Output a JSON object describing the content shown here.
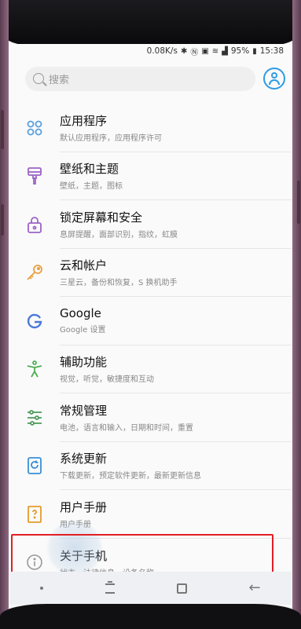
{
  "status_bar": {
    "speed": "0.08K/s",
    "icons": [
      "bluetooth-icon",
      "nfc-icon",
      "vibrate-icon",
      "wifi-icon",
      "signal-icon",
      "battery-icon"
    ],
    "battery": "95%",
    "time": "15:38"
  },
  "search": {
    "placeholder": "搜索"
  },
  "settings": [
    {
      "title": "应用程序",
      "subtitle": "默认应用程序，应用程序许可",
      "icon": "apps-icon",
      "color": "#5aa0e0"
    },
    {
      "title": "壁纸和主题",
      "subtitle": "壁纸，主题，图标",
      "icon": "brush-icon",
      "color": "#9a64c8"
    },
    {
      "title": "锁定屏幕和安全",
      "subtitle": "息屏提醒，面部识别，指纹，虹膜",
      "icon": "lock-icon",
      "color": "#9a64c8"
    },
    {
      "title": "云和帐户",
      "subtitle": "三星云，备份和恢复，S 换机助手",
      "icon": "key-icon",
      "color": "#e9a040"
    },
    {
      "title": "Google",
      "subtitle": "Google 设置",
      "icon": "google-icon",
      "color": "#4a78d8"
    },
    {
      "title": "辅助功能",
      "subtitle": "视觉，听觉，敏捷度和互动",
      "icon": "accessibility-icon",
      "color": "#4caf50"
    },
    {
      "title": "常规管理",
      "subtitle": "电池，语言和输入，日期和时间，重置",
      "icon": "sliders-icon",
      "color": "#4c9a5a"
    },
    {
      "title": "系统更新",
      "subtitle": "下载更新，预定软件更新，最新更新信息",
      "icon": "update-icon",
      "color": "#3a8fd8"
    },
    {
      "title": "用户手册",
      "subtitle": "用户手册",
      "icon": "manual-icon",
      "color": "#e69b2c"
    },
    {
      "title": "关于手机",
      "subtitle": "状态，法律信息，设备名称",
      "icon": "info-icon",
      "color": "#999999"
    }
  ],
  "colors": {
    "accent": "#2f9be2",
    "highlight": "#e11f25"
  }
}
